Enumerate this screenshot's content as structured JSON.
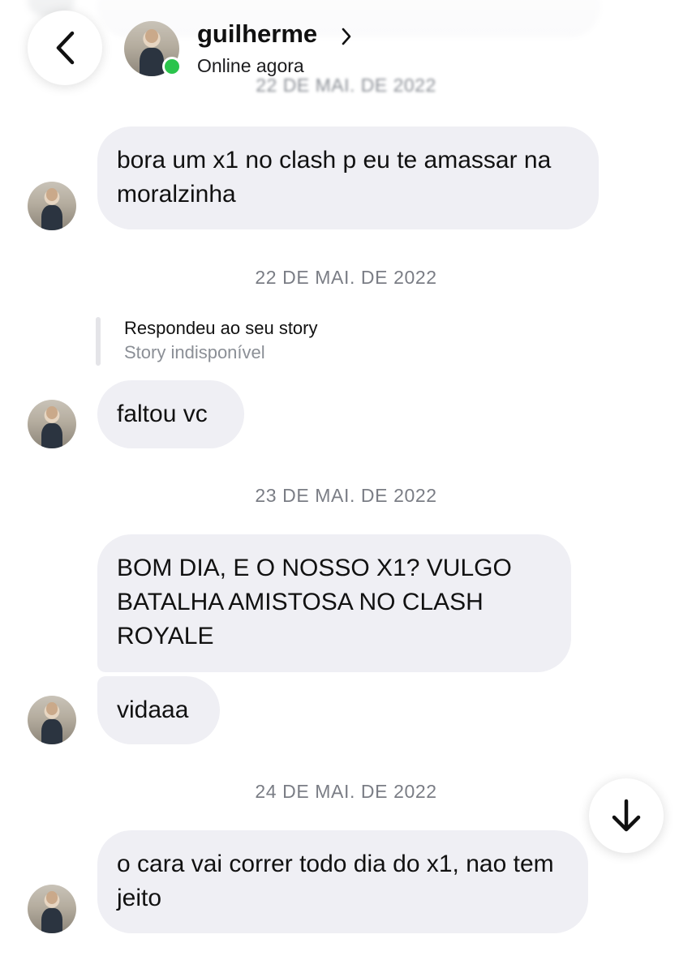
{
  "header": {
    "contact_name": "guilherme",
    "status": "Online agora",
    "blurred_date": "22 DE MAI. DE 2022"
  },
  "icons": {
    "back": "chevron-left-icon",
    "name_chevron": "chevron-right-icon",
    "scroll_down": "arrow-down-icon"
  },
  "colors": {
    "bubble_bg": "#efeff4",
    "online_dot": "#2bc44c",
    "date_text": "#7a7d85"
  },
  "messages": [
    {
      "type": "text",
      "text": "bora um x1 no clash p eu te amassar na moralzinha"
    },
    {
      "type": "date",
      "text": "22 DE MAI. DE 2022"
    },
    {
      "type": "story_reply",
      "title": "Respondeu ao seu story",
      "subtitle": "Story indisponível"
    },
    {
      "type": "text",
      "text": "faltou vc"
    },
    {
      "type": "date",
      "text": "23 DE MAI. DE 2022"
    },
    {
      "type": "text",
      "text": "BOM DIA, E O NOSSO X1? VULGO BATALHA AMISTOSA NO CLASH ROYALE"
    },
    {
      "type": "text",
      "text": "vidaaa"
    },
    {
      "type": "date",
      "text": "24 DE MAI. DE 2022"
    },
    {
      "type": "text",
      "text": "o cara vai correr todo dia do x1, nao tem jeito"
    }
  ]
}
